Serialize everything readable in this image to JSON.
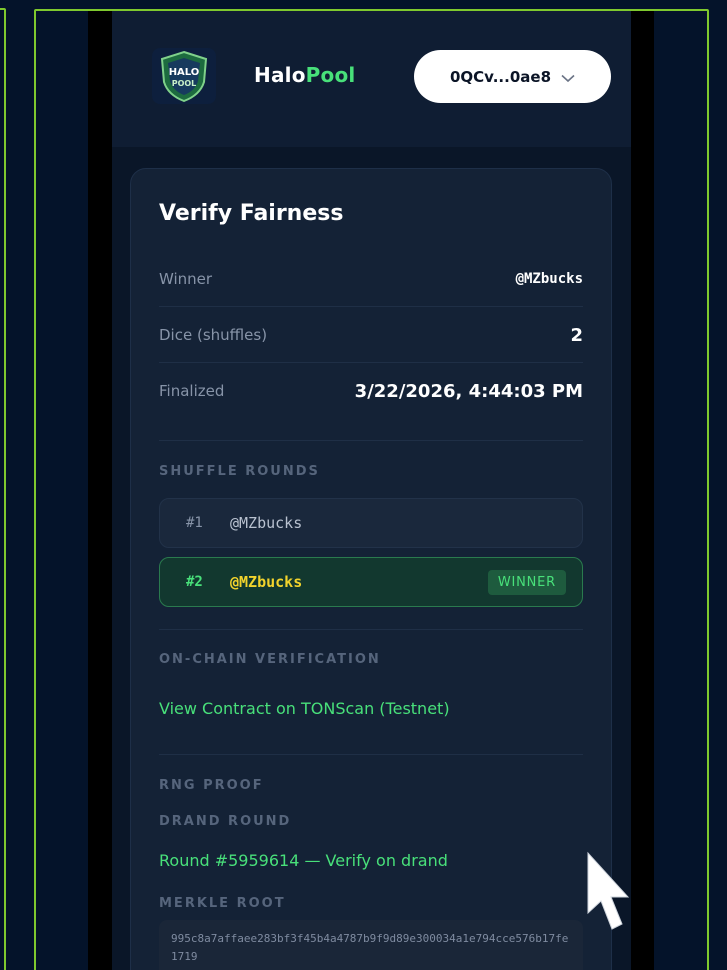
{
  "header": {
    "logo_top": "HALO",
    "logo_bottom": "POOL",
    "brand_prefix": "Halo",
    "brand_suffix": "Pool",
    "wallet_label": "0QCv...0ae8"
  },
  "card": {
    "title": "Verify Fairness",
    "details": [
      {
        "label": "Winner",
        "value": "@MZbucks"
      },
      {
        "label": "Dice (shuffles)",
        "value": "2"
      },
      {
        "label": "Finalized",
        "value": "3/22/2026, 4:44:03 PM"
      }
    ],
    "shuffle_rounds_label": "SHUFFLE ROUNDS",
    "rounds": [
      {
        "num": "#1",
        "name": "@MZbucks"
      },
      {
        "num": "#2",
        "name": "@MZbucks",
        "badge": "WINNER"
      }
    ],
    "onchain_label": "ON-CHAIN VERIFICATION",
    "contract_link": "View Contract on TONScan (Testnet)",
    "rng_proof_label": "RNG PROOF",
    "drand_round_label": "DRAND ROUND",
    "drand_link": "Round #5959614 — Verify on drand",
    "merkle_root_label": "MERKLE ROOT",
    "merkle_root_value": "995c8a7affaee283bf3f45b4a4787b9f9d89e300034a1e794cce576b17fe1719"
  },
  "colors": {
    "frame": "#7fc92e",
    "accent_green": "#48e07a",
    "winner_yellow": "#f2d32c",
    "card_bg": "#142236"
  },
  "icons": {
    "logo": "halo-pool-shield-icon",
    "wallet_chevron": "chevron-down-icon",
    "cursor": "mouse-pointer-icon"
  }
}
